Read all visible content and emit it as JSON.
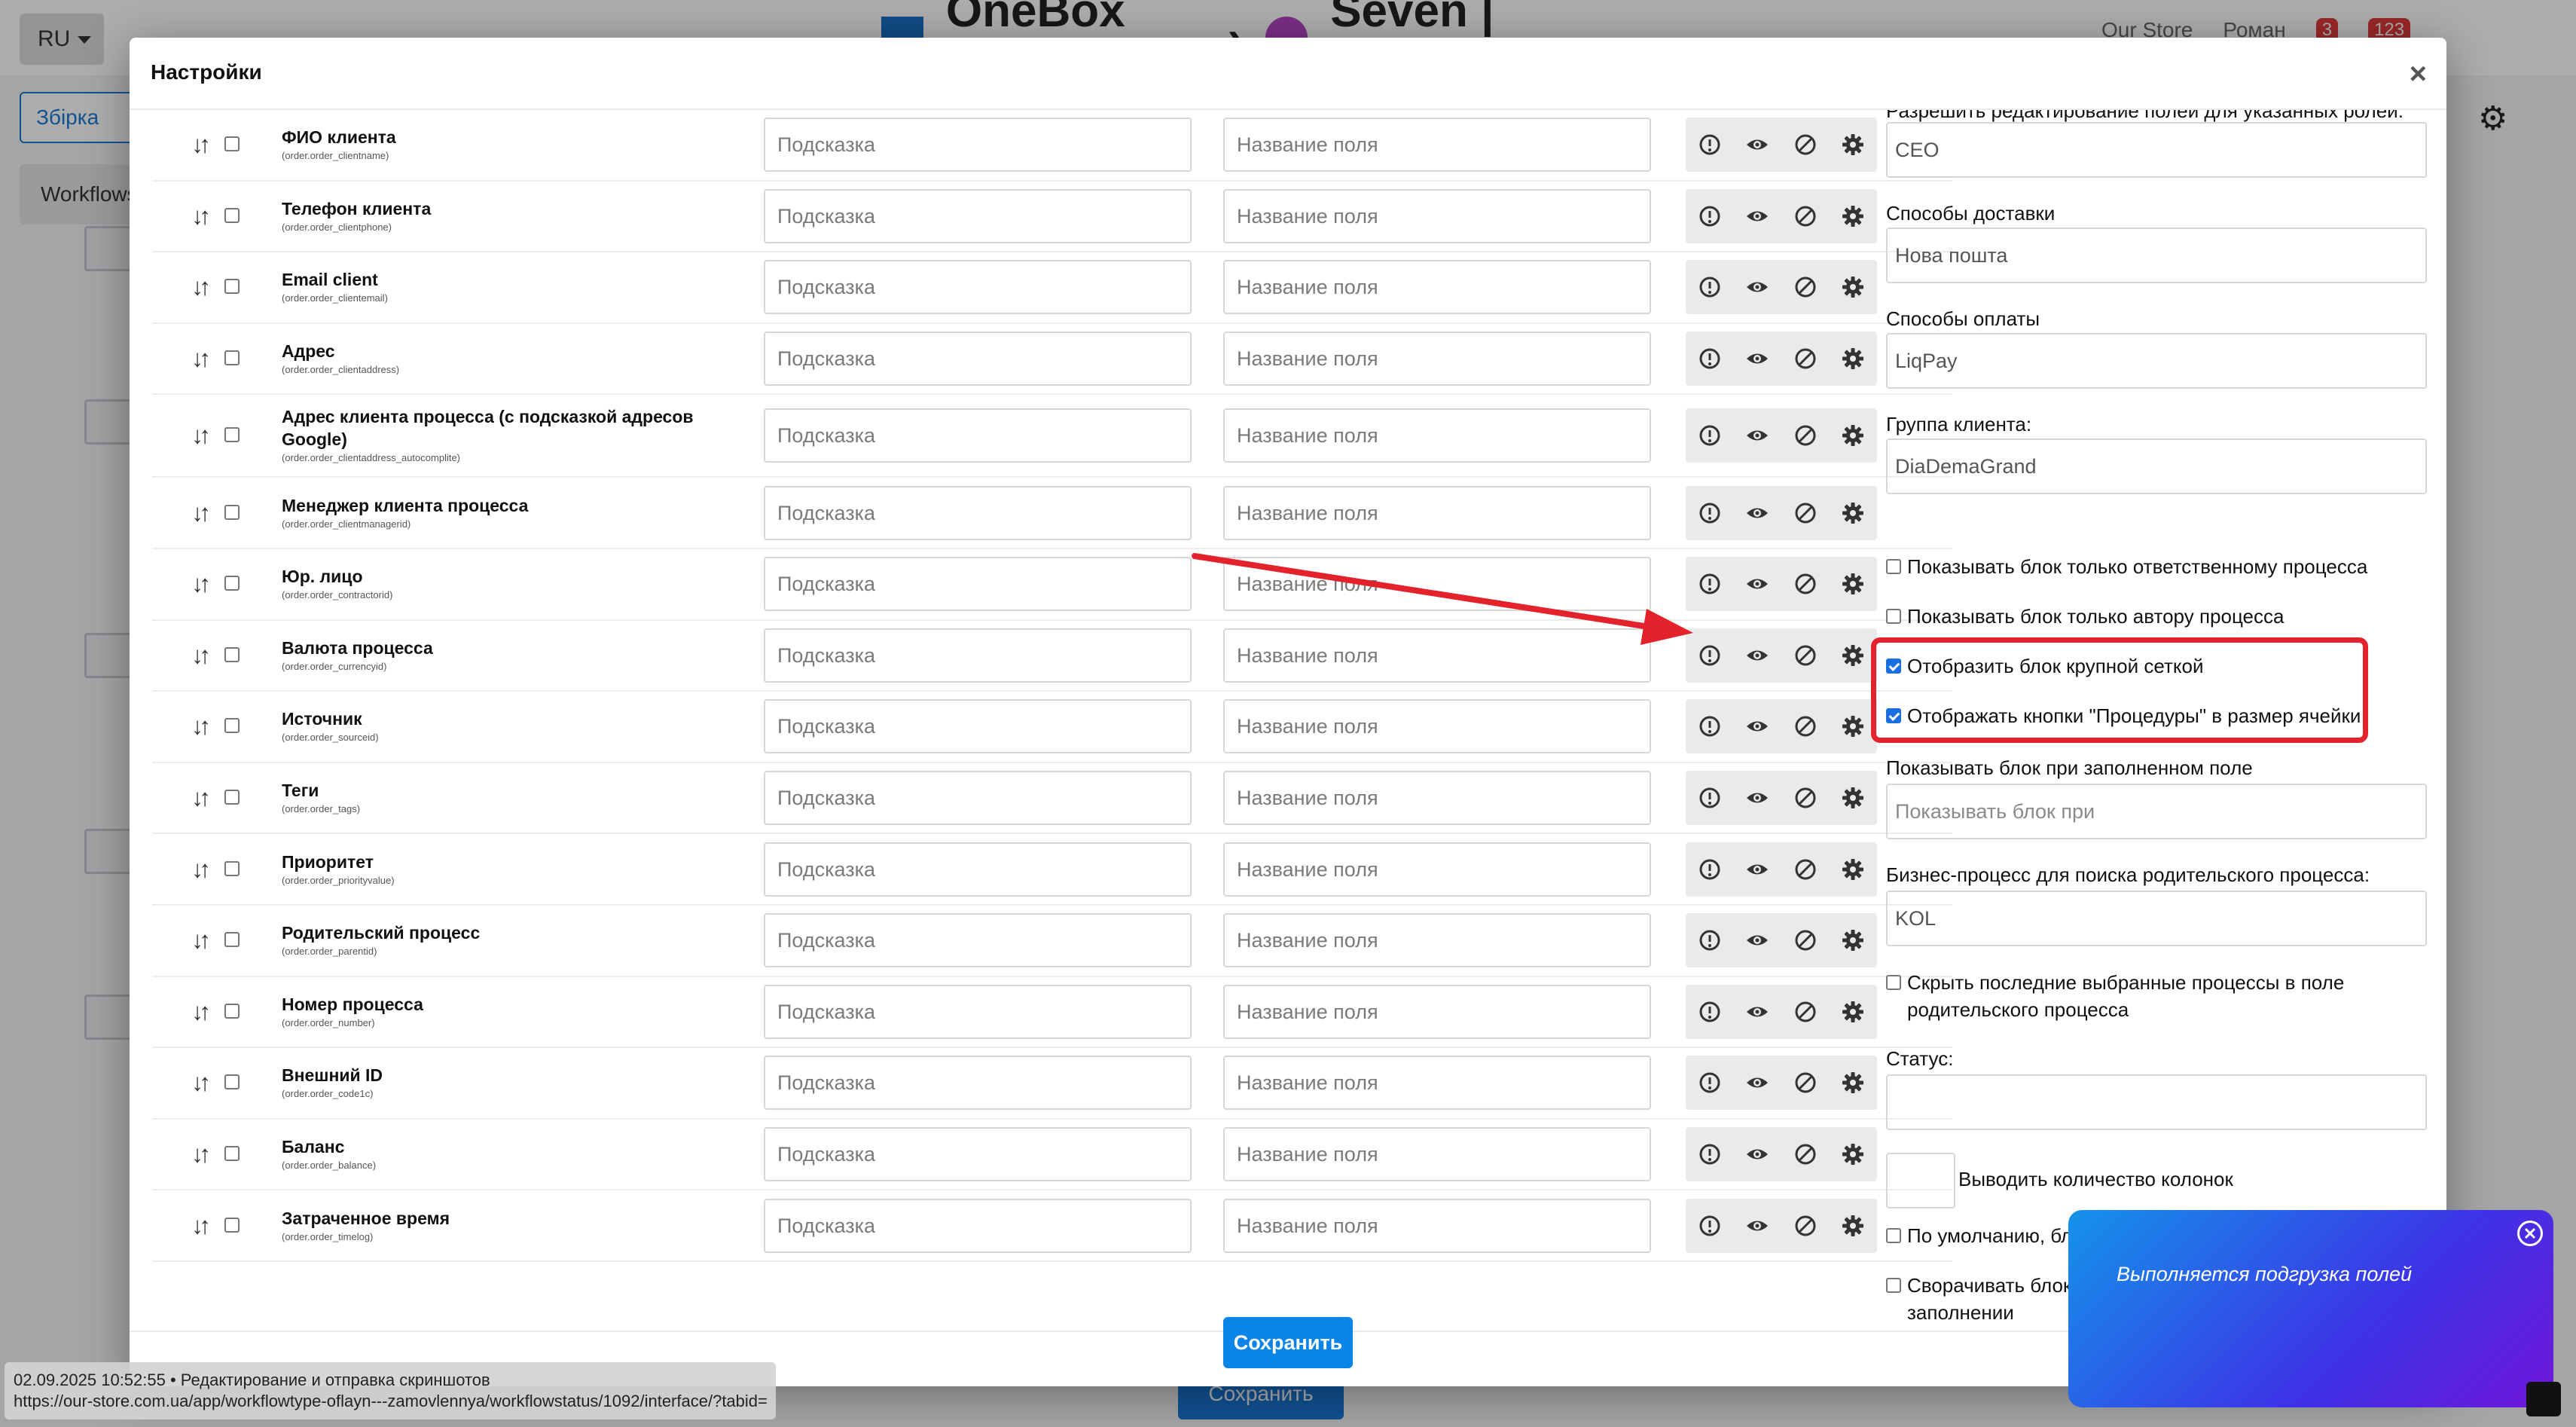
{
  "background": {
    "lang": "RU",
    "logo_left": "OneBox OS",
    "logo_right": "Seven | Офлайн",
    "user_store": "Our Store",
    "user_name": "Роман",
    "notif_1": "3",
    "notif_2": "123",
    "collection_btn": "Збірка",
    "tab": "Workflows",
    "save_label": "Сохранить"
  },
  "modal": {
    "title": "Настройки",
    "close": "×",
    "save_label": "Сохранить",
    "placeholders": {
      "hint": "Подсказка",
      "name": "Название поля"
    },
    "rows": [
      {
        "label": "ФИО клиента",
        "code": "(order.order_clientname)"
      },
      {
        "label": "Телефон клиента",
        "code": "(order.order_clientphone)"
      },
      {
        "label": "Email client",
        "code": "(order.order_clientemail)"
      },
      {
        "label": "Адрес",
        "code": "(order.order_clientaddress)"
      },
      {
        "label": "Адрес клиента процесса (с подсказкой адресов Google)",
        "code": "(order.order_clientaddress_autocomplite)"
      },
      {
        "label": "Менеджер клиента процесса",
        "code": "(order.order_clientmanagerid)"
      },
      {
        "label": "Юр. лицо",
        "code": "(order.order_contractorid)"
      },
      {
        "label": "Валюта процесса",
        "code": "(order.order_currencyid)"
      },
      {
        "label": "Источник",
        "code": "(order.order_sourceid)"
      },
      {
        "label": "Теги",
        "code": "(order.order_tags)"
      },
      {
        "label": "Приоритет",
        "code": "(order.order_priorityvalue)"
      },
      {
        "label": "Родительский процесс",
        "code": "(order.order_parentid)"
      },
      {
        "label": "Номер процесса",
        "code": "(order.order_number)"
      },
      {
        "label": "Внешний ID",
        "code": "(order.order_code1c)"
      },
      {
        "label": "Баланс",
        "code": "(order.order_balance)"
      },
      {
        "label": "Затраченное время",
        "code": "(order.order_timelog)"
      }
    ]
  },
  "right": {
    "edit_roles_label": "Разрешить редактирование полей для указанных ролей:",
    "edit_roles_value": "CEO",
    "delivery_label": "Способы доставки",
    "delivery_value": "Нова пошта",
    "payment_label": "Способы оплаты",
    "payment_value": "LiqPay",
    "client_group_label": "Группа клиента:",
    "client_group_value": "DiaDemaGrand",
    "check_responsible": "Показывать блок только ответственному процесса",
    "check_author": "Показывать блок только автору процесса",
    "check_large_grid": "Отобразить блок крупной сеткой",
    "check_proc_buttons": "Отображать кнопки \"Процедуры\" в размер ячейки",
    "show_filled_label": "Показывать блок при заполненном поле",
    "show_filled_placeholder": "Показывать блок при",
    "parent_bp_label": "Бизнес-процесс для поиска родительского процесса:",
    "parent_bp_value": "KOL",
    "check_hide_last": "Скрыть последние выбранные процессы в поле родительского процесса",
    "status_label": "Статус:",
    "columns_label": "Выводить количество колонок",
    "check_collapsed": "По умолчанию, блок всегда свёрнут",
    "check_collapse_info": "Сворачивать блок при заполнении информации"
  },
  "toast": {
    "text": "Выполняется подгрузка полей"
  },
  "statusbar": {
    "line1": "02.09.2025 10:52:55 • Редактирование и отправка скриншотов",
    "line2": "https://our-store.com.ua/app/workflowtype-oflayn---zamovlennya/workflowstatus/1092/interface/?tabid="
  },
  "colors": {
    "accent": "#0b84e8",
    "highlight": "#e4222c",
    "checked": "#1a6fe0"
  },
  "icons": [
    "sort-arrows-icon",
    "info-circle-icon",
    "eye-icon",
    "ban-icon",
    "gear-icon"
  ]
}
